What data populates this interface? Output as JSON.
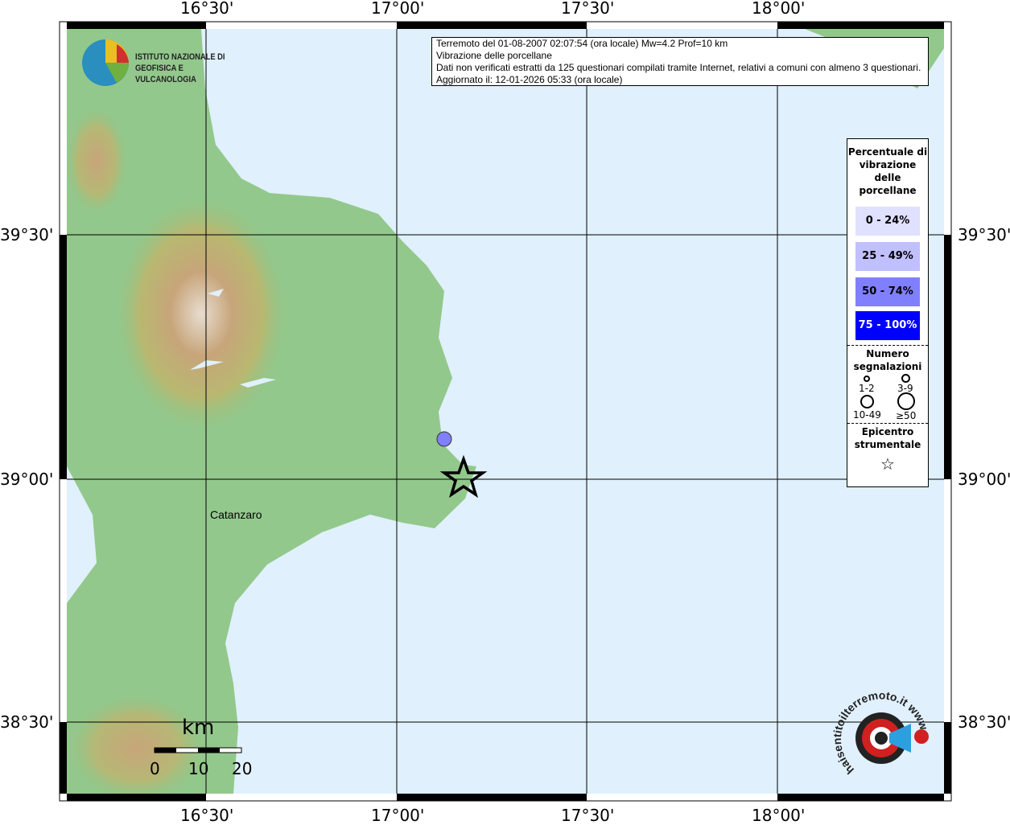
{
  "axes": {
    "lon_labels": [
      "16°30'",
      "17°00'",
      "17°30'",
      "18°00'"
    ],
    "lat_labels": [
      "39°30'",
      "39°00'",
      "38°30'"
    ]
  },
  "info": {
    "line1": "Terremoto del 01-08-2007 02:07:54 (ora locale) Mw=4.2 Prof=10 km",
    "line2": "Vibrazione delle porcellane",
    "line3": "Dati non verificati estratti da 125 questionari compilati tramite Internet, relativi a comuni con almeno 3 questionari.",
    "line4": "Aggiornato il: 12-01-2026 05:33 (ora locale)"
  },
  "legend": {
    "title": "Percentuale di vibrazione delle porcellane",
    "classes": [
      {
        "label": "0 - 24%",
        "color": "#e0e0ff"
      },
      {
        "label": "25 - 49%",
        "color": "#c0c0ff"
      },
      {
        "label": "50 - 74%",
        "color": "#8080ff"
      },
      {
        "label": "75 - 100%",
        "color": "#0000ff"
      }
    ],
    "count_title": "Numero segnalazioni",
    "counts": [
      "1-2",
      "3-9",
      "10-49",
      "≥50"
    ],
    "epicenter_title": "Epicentro strumentale"
  },
  "city": "Catanzaro",
  "scale": {
    "unit": "km",
    "ticks": [
      "0",
      "10",
      "20"
    ]
  },
  "logos": {
    "ingv": "ISTITUTO NAZIONALE DI GEOFISICA E VULCANOLOGIA",
    "hsit": "haisentitoilterremoto.it www"
  },
  "observations": [
    {
      "class": "50 - 74%",
      "count": "3-9"
    }
  ]
}
